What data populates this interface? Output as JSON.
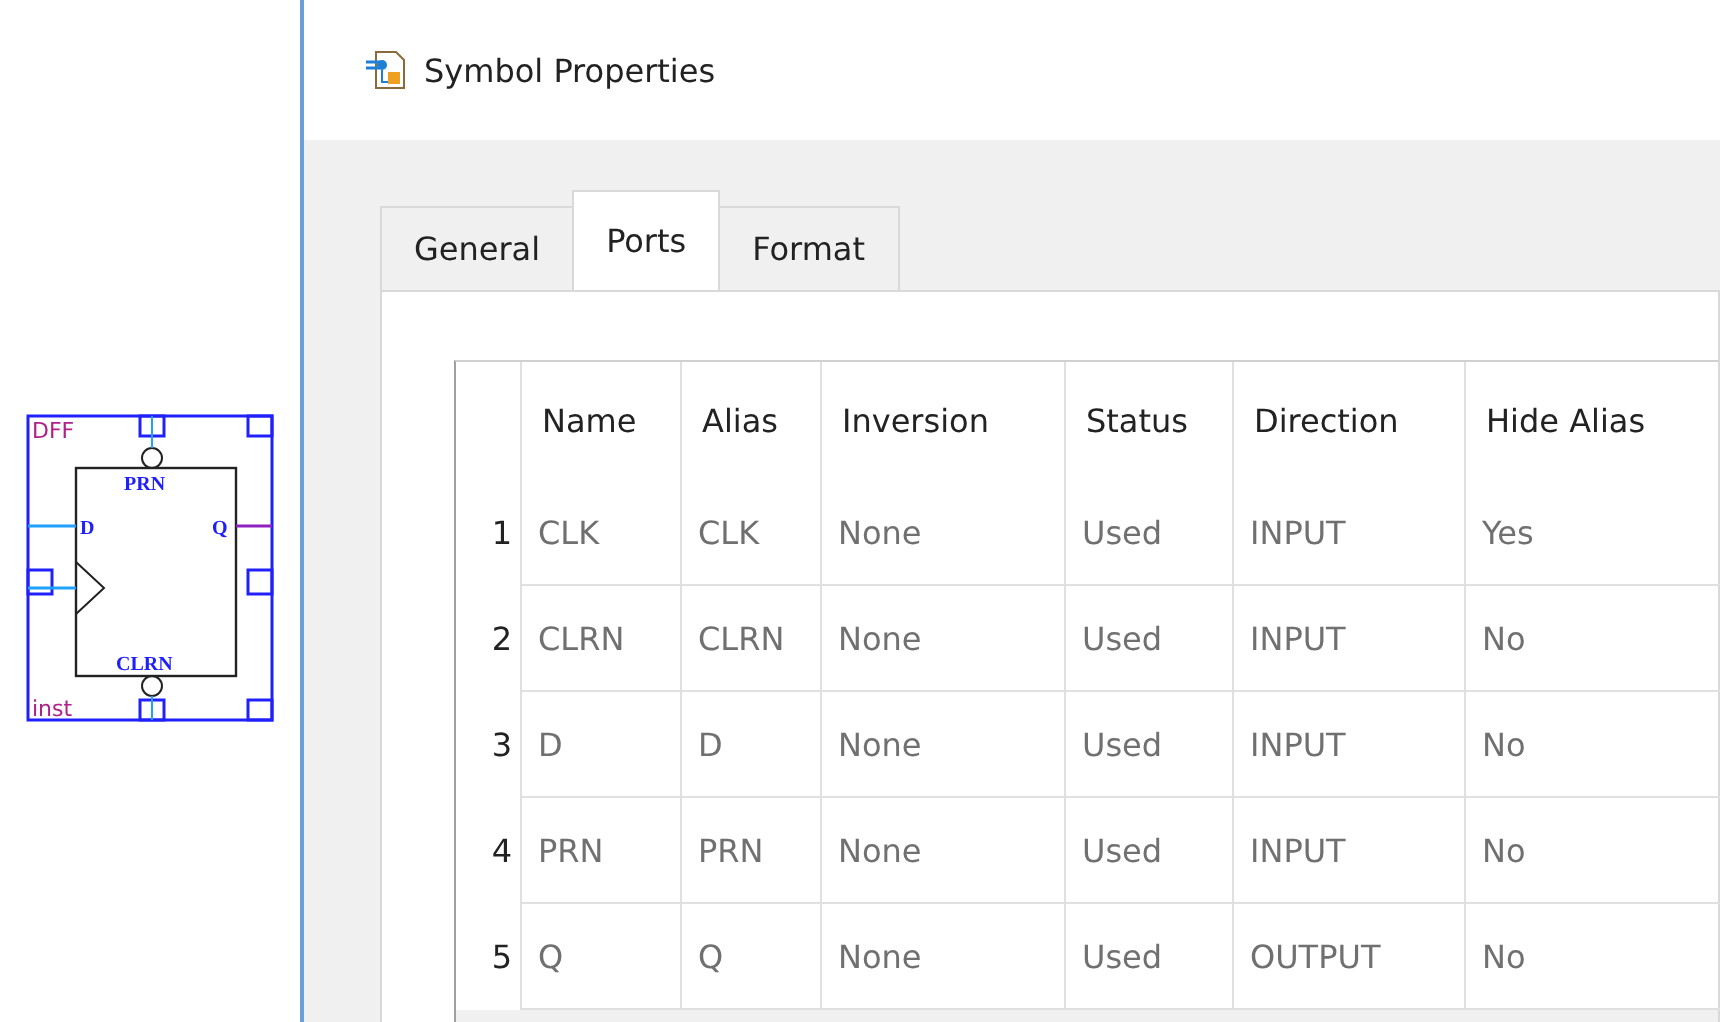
{
  "symbol": {
    "name": "DFF",
    "instance": "inst",
    "labels": {
      "preset": "PRN",
      "data": "D",
      "output": "Q",
      "clear": "CLRN"
    }
  },
  "window": {
    "title": "Symbol Properties"
  },
  "tabs": [
    {
      "label": "General",
      "selected": false
    },
    {
      "label": "Ports",
      "selected": true
    },
    {
      "label": "Format",
      "selected": false
    }
  ],
  "table": {
    "columns": [
      "Name",
      "Alias",
      "Inversion",
      "Status",
      "Direction",
      "Hide Alias"
    ],
    "rows": [
      {
        "index": "1",
        "cells": [
          "CLK",
          "CLK",
          "None",
          "Used",
          "INPUT",
          "Yes"
        ]
      },
      {
        "index": "2",
        "cells": [
          "CLRN",
          "CLRN",
          "None",
          "Used",
          "INPUT",
          "No"
        ]
      },
      {
        "index": "3",
        "cells": [
          "D",
          "D",
          "None",
          "Used",
          "INPUT",
          "No"
        ]
      },
      {
        "index": "4",
        "cells": [
          "PRN",
          "PRN",
          "None",
          "Used",
          "INPUT",
          "No"
        ]
      },
      {
        "index": "5",
        "cells": [
          "Q",
          "Q",
          "None",
          "Used",
          "OUTPUT",
          "No"
        ]
      }
    ]
  }
}
